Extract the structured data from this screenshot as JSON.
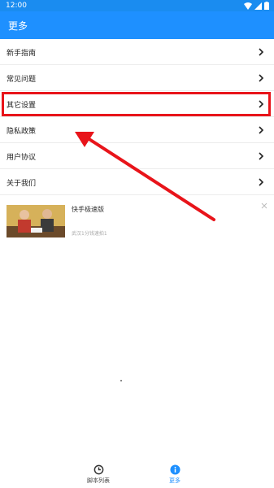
{
  "status_bar": {
    "time": "12:00"
  },
  "header": {
    "title": "更多"
  },
  "menu": {
    "items": [
      {
        "label": "新手指南"
      },
      {
        "label": "常见问题"
      },
      {
        "label": "其它设置"
      },
      {
        "label": "隐私政策"
      },
      {
        "label": "用户协议"
      },
      {
        "label": "关于我们"
      }
    ]
  },
  "ad": {
    "title": "快手极速版",
    "description": "武汉1分钱速拍1"
  },
  "bottom_nav": {
    "items": [
      {
        "label": "脚本列表",
        "icon": "clock-icon",
        "active": false
      },
      {
        "label": "更多",
        "icon": "info-icon",
        "active": true
      }
    ]
  },
  "colors": {
    "primary": "#1e90ff",
    "highlight": "#e8141a"
  }
}
